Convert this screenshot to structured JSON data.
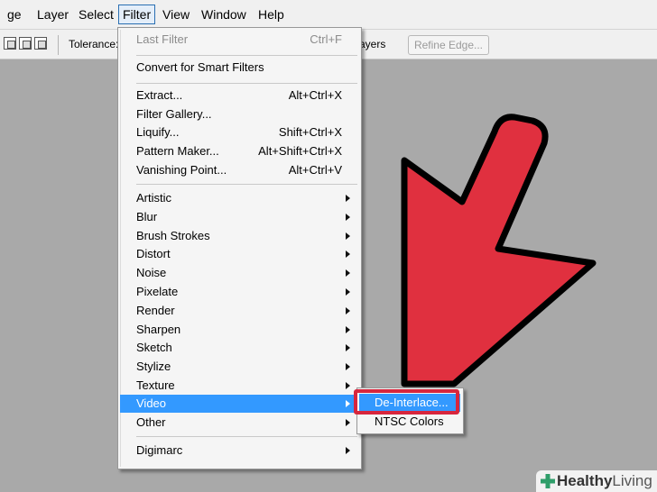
{
  "menubar": {
    "items": [
      {
        "label": "ge",
        "name": "menu-image-partial"
      },
      {
        "label": "Layer",
        "name": "menu-layer"
      },
      {
        "label": "Select",
        "name": "menu-select"
      },
      {
        "label": "Filter",
        "name": "menu-filter",
        "active": true
      },
      {
        "label": "View",
        "name": "menu-view"
      },
      {
        "label": "Window",
        "name": "menu-window"
      },
      {
        "label": "Help",
        "name": "menu-help"
      }
    ]
  },
  "options_bar": {
    "tolerance_label": "Tolerance:",
    "layers_label": "ayers",
    "refine_edge_label": "Refine Edge..."
  },
  "filter_menu": {
    "last_filter": {
      "label": "Last Filter",
      "shortcut": "Ctrl+F"
    },
    "convert_smart": {
      "label": "Convert for Smart Filters"
    },
    "group1": [
      {
        "label": "Extract...",
        "shortcut": "Alt+Ctrl+X"
      },
      {
        "label": "Filter Gallery...",
        "shortcut": ""
      },
      {
        "label": "Liquify...",
        "shortcut": "Shift+Ctrl+X"
      },
      {
        "label": "Pattern Maker...",
        "shortcut": "Alt+Shift+Ctrl+X"
      },
      {
        "label": "Vanishing Point...",
        "shortcut": "Alt+Ctrl+V"
      }
    ],
    "submenus": [
      {
        "label": "Artistic"
      },
      {
        "label": "Blur"
      },
      {
        "label": "Brush Strokes"
      },
      {
        "label": "Distort"
      },
      {
        "label": "Noise"
      },
      {
        "label": "Pixelate"
      },
      {
        "label": "Render"
      },
      {
        "label": "Sharpen"
      },
      {
        "label": "Sketch"
      },
      {
        "label": "Stylize"
      },
      {
        "label": "Texture"
      },
      {
        "label": "Video",
        "highlighted": true
      },
      {
        "label": "Other"
      }
    ],
    "digimarc": {
      "label": "Digimarc"
    }
  },
  "video_submenu": {
    "items": [
      {
        "label": "De-Interlace...",
        "highlighted": true
      },
      {
        "label": "NTSC Colors"
      }
    ]
  },
  "colors": {
    "highlight": "#3399ff",
    "callout": "#d7263d",
    "pointer_arrow": "#e0303f",
    "canvas": "#a9a9a9"
  },
  "watermark": {
    "brand_bold": "Healthy",
    "brand_light": "Living"
  }
}
